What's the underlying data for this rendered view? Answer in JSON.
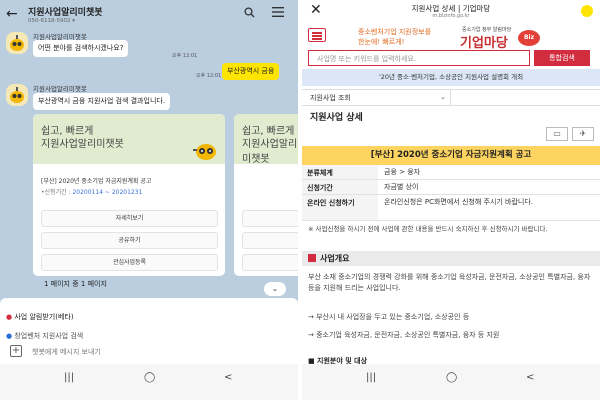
{
  "left": {
    "header": {
      "title": "지원사업알리미챗봇",
      "subtitle": "050-6118-5902 ▾"
    },
    "bot_name": "지원사업알리미챗봇",
    "msg1": "어떤 분야를 검색하시겠나요?",
    "time1": "오후 12:01",
    "user_msg": "부산광역시 금융",
    "time_user": "오후 12:01",
    "msg2": "부산광역시 금융 지원사업 검색 결과입니다.",
    "cards": [
      {
        "banner_line1": "쉽고, 빠르게",
        "banner_line2": "지원사업알리미챗봇",
        "title": "[부산] 2020년 중소기업 자금지원계획 공고",
        "period_label": "•신청기간 : ",
        "period_value": "20200114 ~ 20201231",
        "buttons": [
          "자세히보기",
          "공유하기",
          "관심사업등록"
        ]
      },
      {
        "banner_line1": "쉽고, 빠르게",
        "banner_line2": "지원사업알리미챗봇"
      }
    ],
    "pager": "1 페이지 중 1 페이지",
    "menu": [
      "사업 알림받기(베타)",
      "창업벤처 지원사업 검색"
    ],
    "input_placeholder": "챗봇에게 메시지 보내기",
    "nav": {
      "recent": "|||",
      "home": "◯",
      "back": "<"
    }
  },
  "right": {
    "browser": {
      "close": "✕",
      "title": "지원사업 상세 | 기업마당",
      "url": "m.bizinfo.go.kr"
    },
    "slogan1": "중소벤처기업 지원정보를",
    "slogan2": "한눈에! 빠르게!",
    "logo_sub": "중소기업 정부 알림마당",
    "logo": "기업마당",
    "logo_badge": "Biz",
    "search_placeholder": "사업명 또는 키워드를 입력하세요.",
    "search_button": "통합검색",
    "notice": "'20년 중소·벤처기업, 소상공인 지원사업 설명회 개최",
    "breadcrumb": "지원사업 조회",
    "section_title": "지원사업 상세",
    "program_title": "[부산] 2020년 중소기업 자금지원계획 공고",
    "info": [
      {
        "k": "분류체계",
        "v": "금융 > 융자"
      },
      {
        "k": "신청기간",
        "v": "자금별 상이"
      },
      {
        "k": "온라인 신청하기",
        "v": "온라인신청은 PC화면에서 신청해 주시기 바랍니다."
      }
    ],
    "warning": "※ 사업신청을 하시기 전에 사업에 관한 내용을 반드시 숙지하신 후 신청하시기 바랍니다.",
    "overview_title": "사업개요",
    "para1": "부산 소재 중소기업의 경쟁력 강화를 위해 중소기업 육성자금, 운전자금, 소상공인 특별자금, 융자 등을 지원해 드리는 사업입니다.",
    "para2": "→ 부산시 내 사업장을 두고 있는 중소기업, 소상공인 등",
    "para3": "→ 중소기업 육성자금, 운전자금, 소상공인 특별자금, 융자 등 지원",
    "cut_line": "■ 지원분야 및 대상",
    "nav": {
      "recent": "|||",
      "home": "◯",
      "back": "<"
    }
  }
}
